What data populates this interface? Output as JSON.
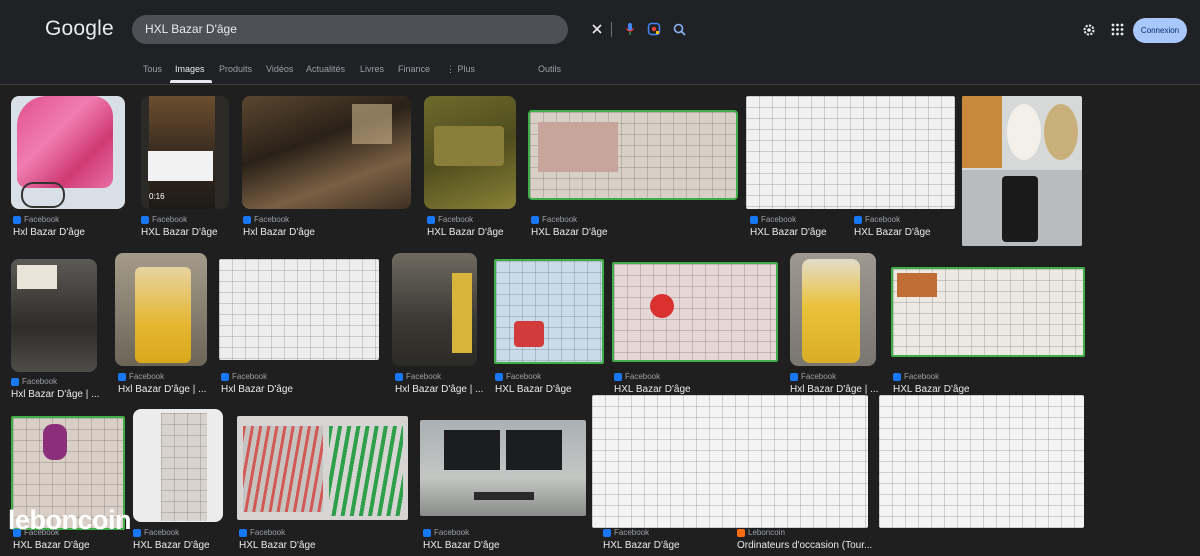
{
  "header": {
    "logo": "Google",
    "search_query": "HXL Bazar D'âge",
    "signin_label": "Connexion"
  },
  "tabs": [
    {
      "label": "Tous"
    },
    {
      "label": "Images"
    },
    {
      "label": "Produits"
    },
    {
      "label": "Vidéos"
    },
    {
      "label": "Actualités"
    },
    {
      "label": "Livres"
    },
    {
      "label": "Finance"
    },
    {
      "label": "⋮ Plus"
    },
    {
      "label": "Outils"
    }
  ],
  "results": [
    {
      "source": "Facebook",
      "title": "Hxl Bazar D'âge"
    },
    {
      "source": "Facebook",
      "title": "HXL Bazar D'âge"
    },
    {
      "source": "Facebook",
      "title": "Hxl Bazar D'âge"
    },
    {
      "source": "Facebook",
      "title": "HXL Bazar D'âge"
    },
    {
      "source": "Facebook",
      "title": "HXL Bazar D'âge"
    },
    {
      "source": "Facebook",
      "title": "HXL Bazar D'âge"
    },
    {
      "source": "Facebook",
      "title": "HXL Bazar D'âge"
    },
    {
      "source": "Facebook",
      "title": "Hxl Bazar D'âge | ..."
    },
    {
      "source": "Facebook",
      "title": "Hxl Bazar D'âge | ..."
    },
    {
      "source": "Facebook",
      "title": "Hxl Bazar D'âge"
    },
    {
      "source": "Facebook",
      "title": "Hxl Bazar D'âge | ..."
    },
    {
      "source": "Facebook",
      "title": "HXL Bazar D'âge"
    },
    {
      "source": "Facebook",
      "title": "HXL Bazar D'âge"
    },
    {
      "source": "Facebook",
      "title": "Hxl Bazar D'âge | ..."
    },
    {
      "source": "Facebook",
      "title": "HXL Bazar D'âge"
    },
    {
      "source": "Facebook",
      "title": "HXL Bazar D'âge"
    },
    {
      "source": "Facebook",
      "title": "HXL Bazar D'âge"
    },
    {
      "source": "Facebook",
      "title": "HXL Bazar D'âge"
    },
    {
      "source": "Facebook",
      "title": "HXL Bazar D'âge"
    },
    {
      "source": "Facebook",
      "title": "HXL Bazar D'âge"
    },
    {
      "source": "Leboncoin",
      "title": "Ordinateurs d'occasion (Tour..."
    }
  ],
  "video_duration": "0:16",
  "watermark": "leboncoin",
  "colors": {
    "background": "#1f1f1f",
    "header": "#202124",
    "search_box": "#4d5156",
    "signin": "#a8c7fa",
    "facebook": "#1877f2"
  }
}
